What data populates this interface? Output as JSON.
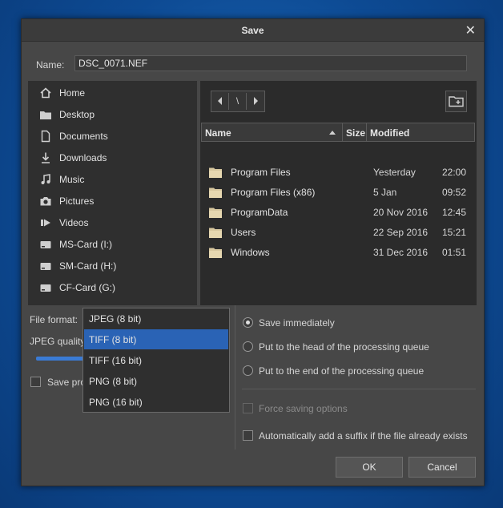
{
  "dialog": {
    "title": "Save"
  },
  "name": {
    "label": "Name:",
    "value": "DSC_0071.NEF"
  },
  "places": [
    {
      "label": "Home",
      "icon": "home-icon"
    },
    {
      "label": "Desktop",
      "icon": "desktop-folder-icon"
    },
    {
      "label": "Documents",
      "icon": "document-icon"
    },
    {
      "label": "Downloads",
      "icon": "download-icon"
    },
    {
      "label": "Music",
      "icon": "music-icon"
    },
    {
      "label": "Pictures",
      "icon": "camera-icon"
    },
    {
      "label": "Videos",
      "icon": "video-icon"
    },
    {
      "label": "MS-Card (I:)",
      "icon": "drive-icon"
    },
    {
      "label": "SM-Card (H:)",
      "icon": "drive-icon"
    },
    {
      "label": "CF-Card (G:)",
      "icon": "drive-icon"
    }
  ],
  "nav": {
    "path_sep": "\\"
  },
  "files": {
    "columns": {
      "name": "Name",
      "size": "Size",
      "modified": "Modified"
    },
    "rows": [
      {
        "name": "Program Files",
        "date": "Yesterday",
        "time": "22:00"
      },
      {
        "name": "Program Files (x86)",
        "date": "5 Jan",
        "time": "09:52"
      },
      {
        "name": "ProgramData",
        "date": "20 Nov 2016",
        "time": "12:45"
      },
      {
        "name": "Users",
        "date": "22 Sep 2016",
        "time": "15:21"
      },
      {
        "name": "Windows",
        "date": "31 Dec 2016",
        "time": "01:51"
      }
    ]
  },
  "format": {
    "label": "File format:",
    "jpeg_quality_label": "JPEG quality",
    "save_profile_label": "Save profile",
    "options": [
      "JPEG (8 bit)",
      "TIFF (8 bit)",
      "TIFF (16 bit)",
      "PNG (8 bit)",
      "PNG (16 bit)"
    ],
    "selected": "TIFF (8 bit)"
  },
  "save_options": {
    "save_immediately": "Save immediately",
    "queue_head": "Put to the head of the processing queue",
    "queue_end": "Put to the end of the processing queue",
    "force_saving": "Force saving options",
    "auto_suffix": "Automatically add a suffix if the file already exists"
  },
  "buttons": {
    "ok": "OK",
    "cancel": "Cancel"
  },
  "colors": {
    "accent": "#2a63b5",
    "slider": "#3a7bd5"
  }
}
